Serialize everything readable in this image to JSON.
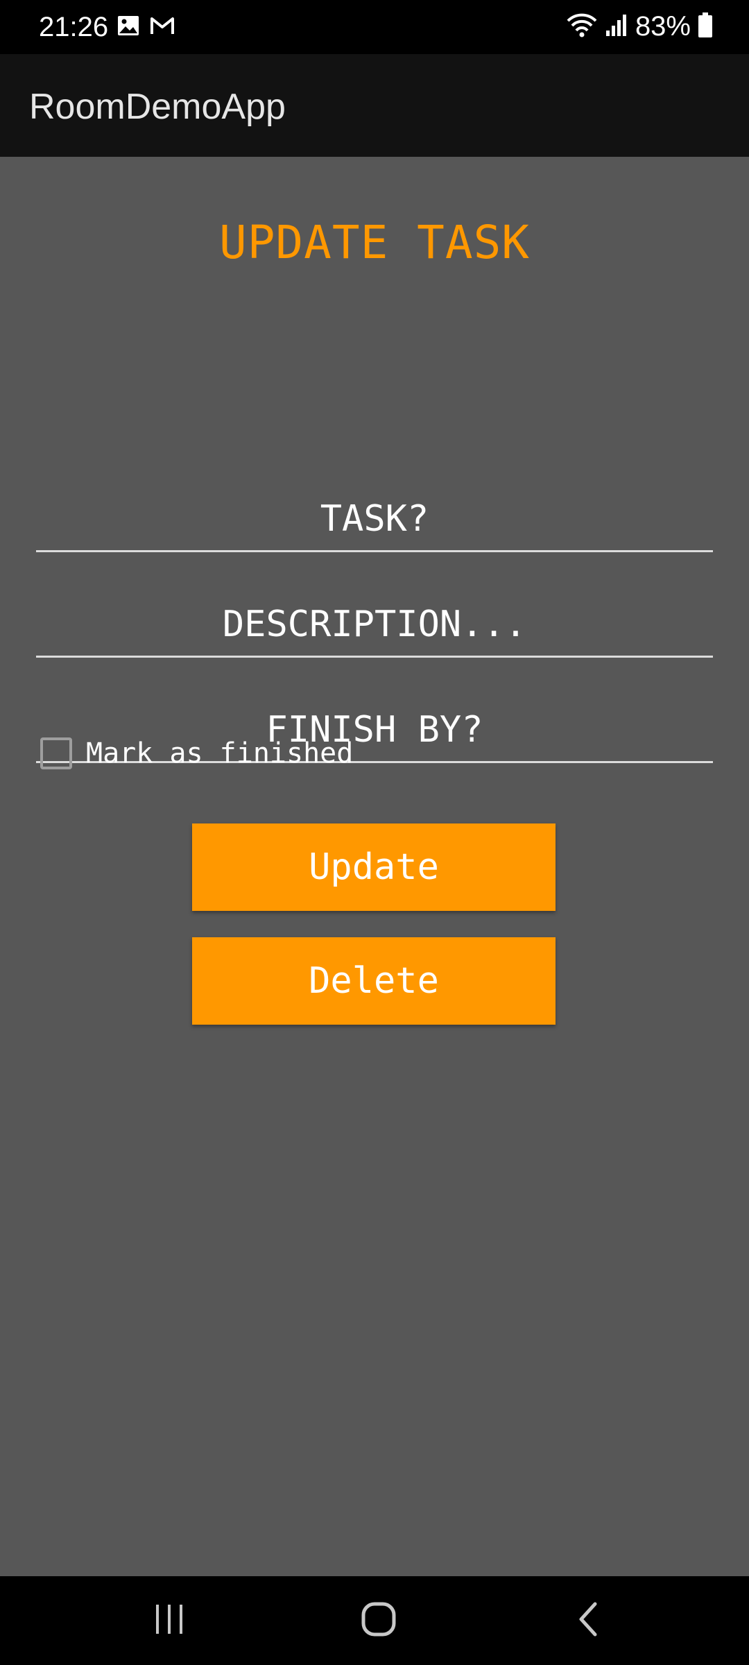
{
  "status_bar": {
    "time": "21:26",
    "battery": "83%",
    "icons_left": [
      "gallery-icon",
      "gmail-icon"
    ],
    "icons_right": [
      "wifi-icon",
      "signal-icon",
      "battery-icon"
    ]
  },
  "app_bar": {
    "title": "RoomDemoApp"
  },
  "screen": {
    "title": "UPDATE TASK",
    "fields": {
      "task": "TASK?",
      "description": "DESCRIPTION...",
      "finish_by": "FINISH BY?"
    },
    "checkbox": {
      "label": "Mark as finished",
      "checked": false
    },
    "buttons": {
      "update": "Update",
      "delete": "Delete"
    }
  },
  "nav_bar": {
    "items": [
      "recents-icon",
      "home-icon",
      "back-icon"
    ]
  },
  "colors": {
    "accent": "#ff9800",
    "background": "#575757",
    "app_bar": "#121212"
  }
}
